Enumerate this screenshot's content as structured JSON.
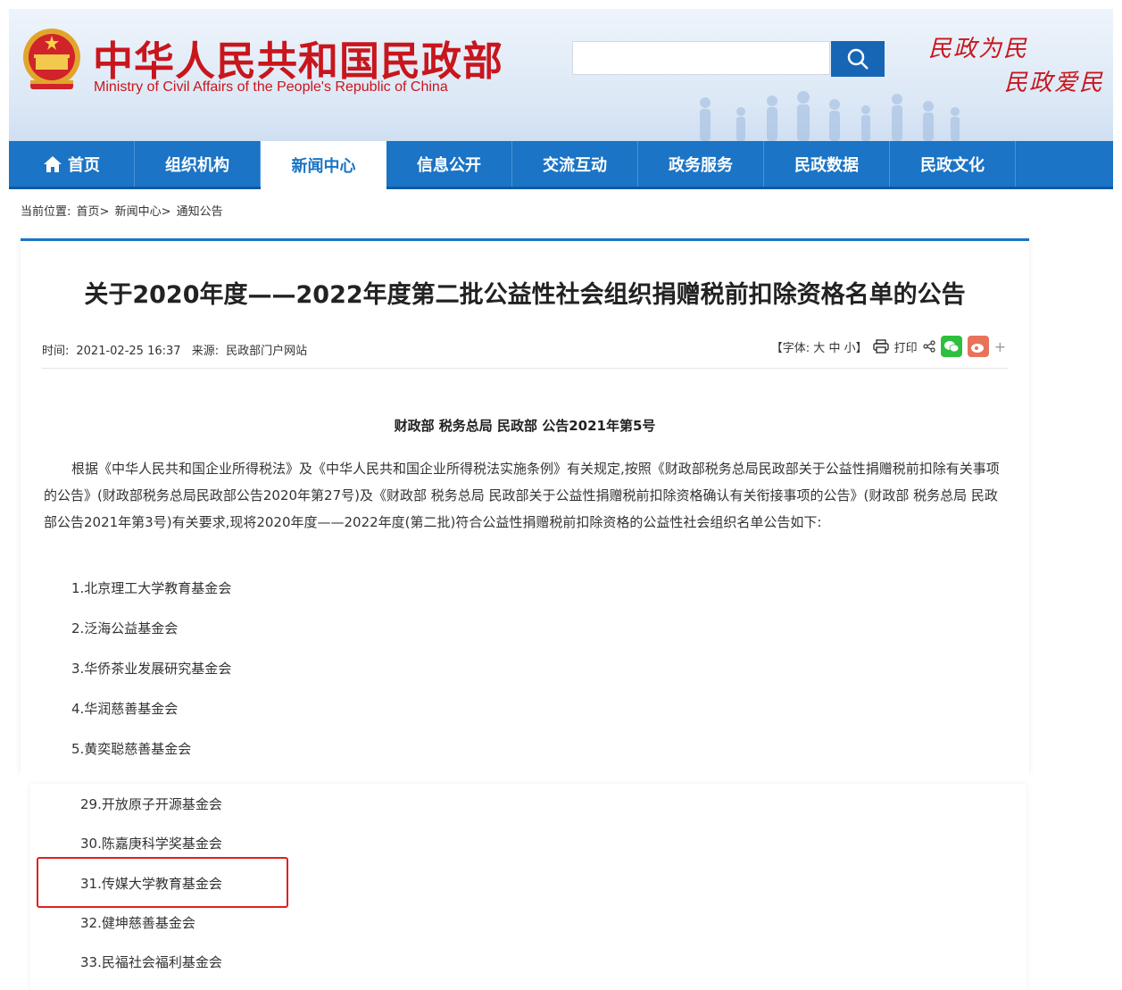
{
  "header": {
    "title": "中华人民共和国民政部",
    "subtitle": "Ministry of Civil Affairs of the People's Republic of China",
    "search_placeholder": "",
    "slogan_line1": "民政为民",
    "slogan_line2": "民政爱民",
    "brand_color": "#c8161d"
  },
  "nav": {
    "items": [
      {
        "label": "首页",
        "icon": "home-icon"
      },
      {
        "label": "组织机构"
      },
      {
        "label": "新闻中心",
        "active": true
      },
      {
        "label": "信息公开"
      },
      {
        "label": "交流互动"
      },
      {
        "label": "政务服务"
      },
      {
        "label": "民政数据"
      },
      {
        "label": "民政文化"
      }
    ],
    "accent": "#1b74c5"
  },
  "breadcrumb": {
    "prefix": "当前位置:",
    "items": [
      "首页>",
      "新闻中心>",
      "通知公告"
    ]
  },
  "article": {
    "title": "关于2020年度——2022年度第二批公益性社会组织捐赠税前扣除资格名单的公告",
    "time_label": "时间:",
    "time": "2021-02-25 16:37",
    "source_label": "来源:",
    "source": "民政部门户网站",
    "font_tools": "【字体: 大 中 小】",
    "print_label": "打印",
    "plus": "+",
    "doc_number": "财政部 税务总局 民政部 公告2021年第5号",
    "body": "根据《中华人民共和国企业所得税法》及《中华人民共和国企业所得税法实施条例》有关规定,按照《财政部税务总局民政部关于公益性捐赠税前扣除有关事项的公告》(财政部税务总局民政部公告2020年第27号)及《财政部 税务总局 民政部关于公益性捐赠税前扣除资格确认有关衔接事项的公告》(财政部 税务总局 民政部公告2021年第3号)有关要求,现将2020年度——2022年度(第二批)符合公益性捐赠税前扣除资格的公益性社会组织名单公告如下:",
    "list": [
      "1.北京理工大学教育基金会",
      "2.泛海公益基金会",
      "3.华侨茶业发展研究基金会",
      "4.华润慈善基金会",
      "5.黄奕聪慈善基金会"
    ]
  },
  "excerpt": {
    "list": [
      "29.开放原子开源基金会",
      "30.陈嘉庚科学奖基金会",
      "31.传媒大学教育基金会",
      "32.健坤慈善基金会",
      "33.民福社会福利基金会"
    ],
    "highlight_color": "#e02020"
  }
}
